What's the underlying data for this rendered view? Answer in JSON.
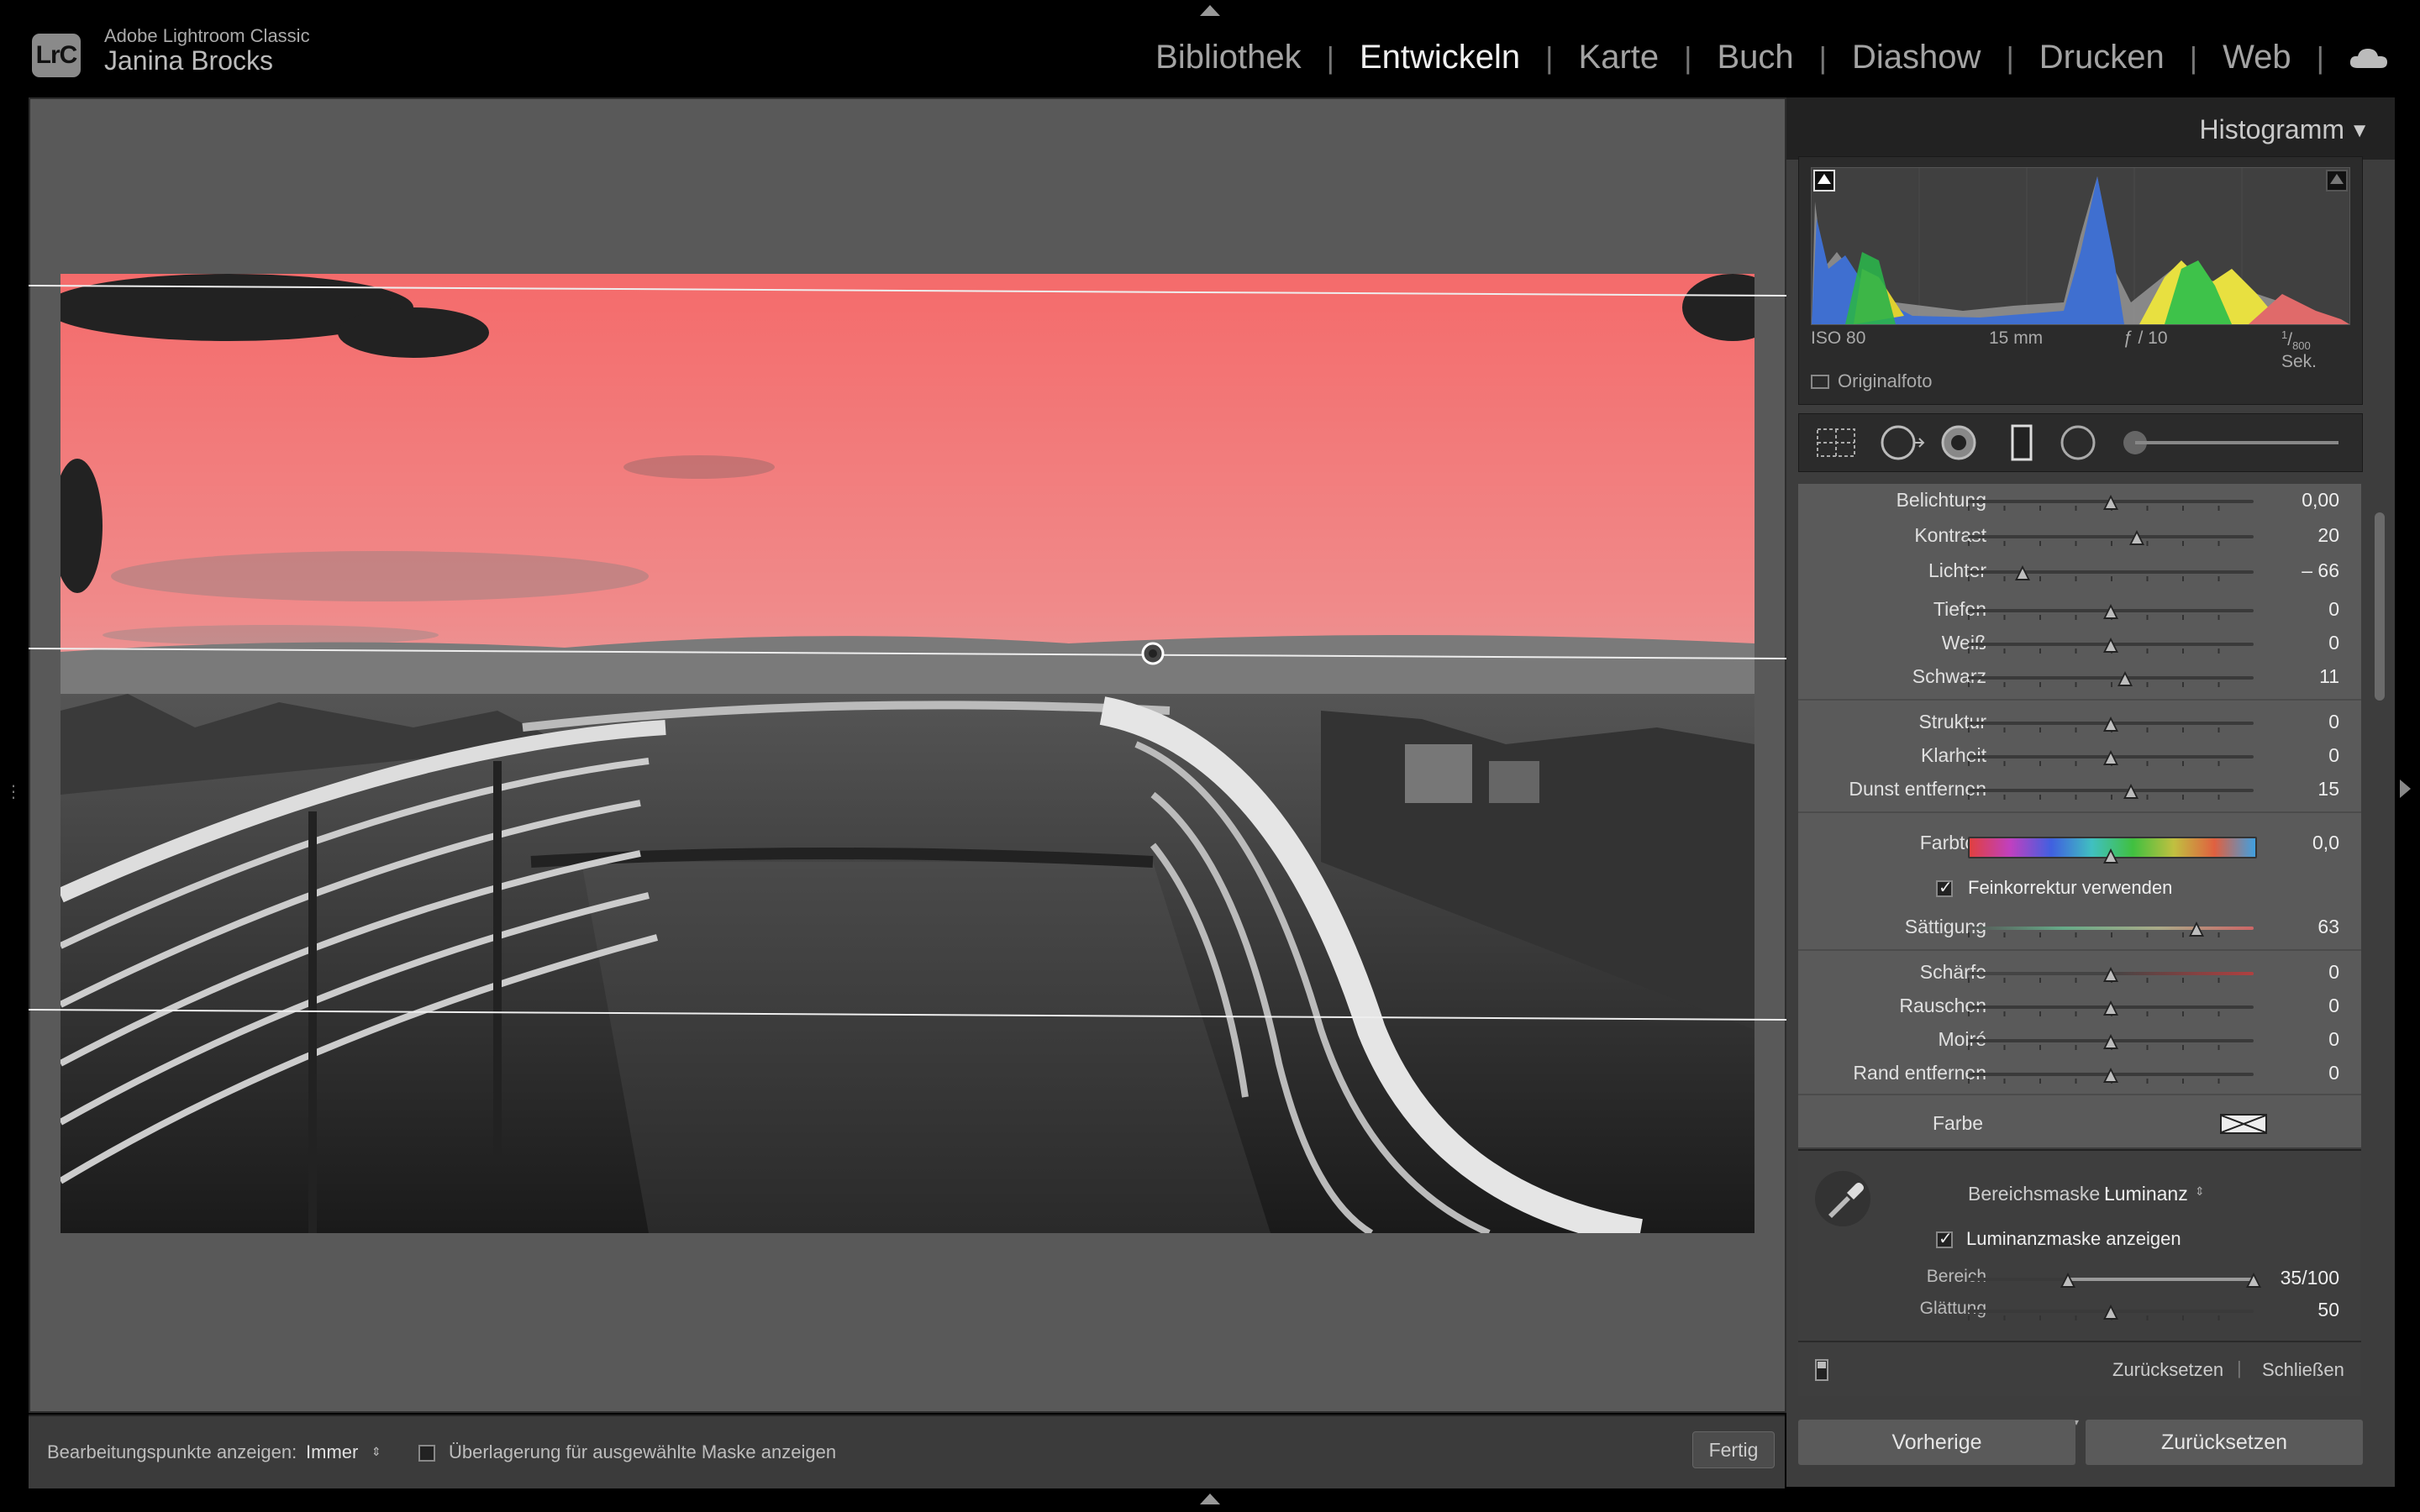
{
  "app": {
    "logo_text": "LrC",
    "product_name": "Adobe Lightroom Classic",
    "user_name": "Janina Brocks"
  },
  "modules": [
    {
      "label": "Bibliothek",
      "active": false
    },
    {
      "label": "Entwickeln",
      "active": true
    },
    {
      "label": "Karte",
      "active": false
    },
    {
      "label": "Buch",
      "active": false
    },
    {
      "label": "Diashow",
      "active": false
    },
    {
      "label": "Drucken",
      "active": false
    },
    {
      "label": "Web",
      "active": false
    }
  ],
  "toolbar": {
    "edit_points_label": "Bearbeitungspunkte anzeigen:",
    "edit_points_value": "Immer",
    "overlay_label": "Überlagerung für ausgewählte Maske anzeigen",
    "done_label": "Fertig"
  },
  "histogram": {
    "title": "Histogramm",
    "iso": "ISO 80",
    "focal": "15 mm",
    "aperture": "ƒ / 10",
    "shutter_num": "1",
    "shutter_den": "800",
    "shutter_unit": "Sek.",
    "original_photo_label": "Originalfoto"
  },
  "sliders": [
    {
      "name": "belichtung",
      "label": "Belichtung",
      "value": "0,00",
      "pos": 0.5
    },
    {
      "name": "kontrast",
      "label": "Kontrast",
      "value": "20",
      "pos": 0.59
    },
    {
      "name": "lichter",
      "label": "Lichter",
      "value": "– 66",
      "pos": 0.19
    },
    {
      "name": "tiefen",
      "label": "Tiefen",
      "value": "0",
      "pos": 0.5
    },
    {
      "name": "weiss",
      "label": "Weiß",
      "value": "0",
      "pos": 0.5
    },
    {
      "name": "schwarz",
      "label": "Schwarz",
      "value": "11",
      "pos": 0.55
    },
    {
      "name": "struktur",
      "label": "Struktur",
      "value": "0",
      "pos": 0.5
    },
    {
      "name": "klarheit",
      "label": "Klarheit",
      "value": "0",
      "pos": 0.5
    },
    {
      "name": "dunst",
      "label": "Dunst entfernen",
      "value": "15",
      "pos": 0.57
    },
    {
      "name": "farbton",
      "label": "Farbton",
      "value": "0,0",
      "pos": 0.5
    },
    {
      "name": "saettigung",
      "label": "Sättigung",
      "value": "63",
      "pos": 0.8
    },
    {
      "name": "schaerfe",
      "label": "Schärfe",
      "value": "0",
      "pos": 0.5
    },
    {
      "name": "rauschen",
      "label": "Rauschen",
      "value": "0",
      "pos": 0.5
    },
    {
      "name": "moire",
      "label": "Moiré",
      "value": "0",
      "pos": 0.5
    },
    {
      "name": "rand",
      "label": "Rand entfernen",
      "value": "0",
      "pos": 0.5
    }
  ],
  "fine_adjust_label": "Feinkorrektur verwenden",
  "color_label": "Farbe",
  "mask": {
    "range_mask_label": "Bereichsmaske :",
    "range_mask_value": "Luminanz",
    "show_mask_label": "Luminanzmaske anzeigen",
    "range_label": "Bereich",
    "range_value": "35/100",
    "range_low": 0.35,
    "range_high": 1.0,
    "smoothing_label": "Glättung",
    "smoothing_value": "50",
    "smoothing_pos": 0.5,
    "reset_label": "Zurücksetzen",
    "close_label": "Schließen"
  },
  "footer": {
    "previous_label": "Vorherige",
    "reset_label": "Zurücksetzen"
  },
  "colors": {
    "mask_overlay": "#ff6464",
    "panel_bg": "#3d3d3d",
    "adjust_bg": "#5a5a5a"
  }
}
